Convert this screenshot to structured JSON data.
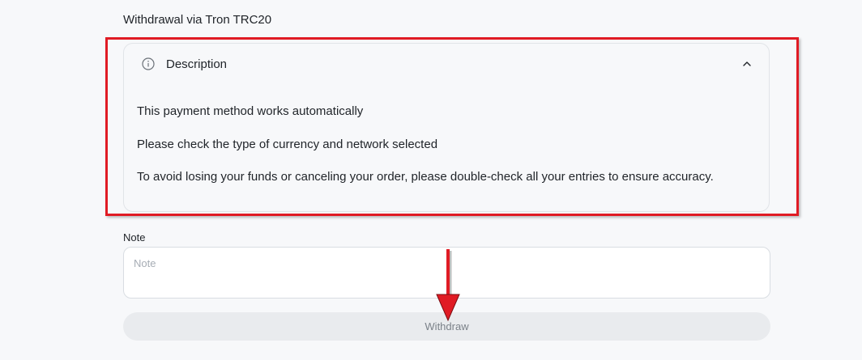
{
  "section": {
    "title": "Withdrawal via Tron TRC20"
  },
  "description": {
    "header_label": "Description",
    "header_icon": "info-icon",
    "toggle_icon": "chevron-up-icon",
    "lines": [
      "This payment method works automatically",
      "Please check the type of currency and network selected",
      "To avoid losing your funds or canceling your order, please double-check all your entries to ensure accuracy."
    ]
  },
  "note": {
    "label": "Note",
    "placeholder": "Note",
    "value": ""
  },
  "actions": {
    "withdraw_label": "Withdraw"
  },
  "colors": {
    "annotation_red": "#e01b24",
    "button_bg": "#e9ebee",
    "page_bg": "#f7f8fa"
  }
}
